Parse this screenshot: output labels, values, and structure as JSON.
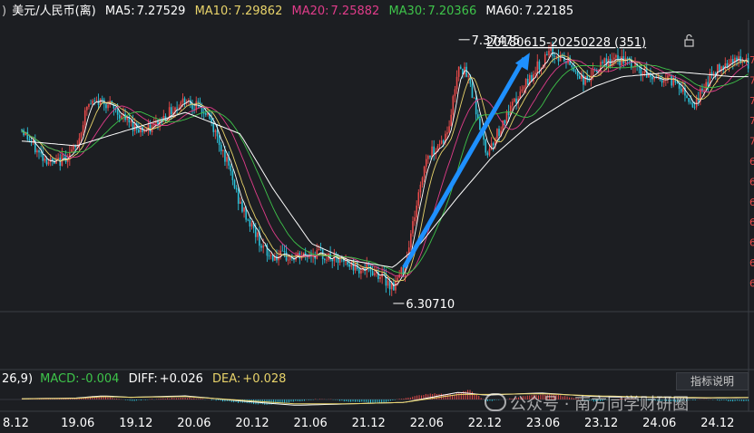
{
  "header": {
    "prefix": ")",
    "symbol": "美元/人民币(离)",
    "ma": [
      {
        "label": "MA5:",
        "value": "7.27529",
        "color": "#ffffff"
      },
      {
        "label": "MA10:",
        "value": "7.29862",
        "color": "#e8d36a"
      },
      {
        "label": "MA20:",
        "value": "7.25882",
        "color": "#e03c8a"
      },
      {
        "label": "MA30:",
        "value": "7.20366",
        "color": "#3ec44a"
      },
      {
        "label": "MA60:",
        "value": "7.22185",
        "color": "#ffffff"
      }
    ]
  },
  "macd_header": {
    "params": "26,9)",
    "macd_label": "MACD:",
    "macd_value": "-0.004",
    "diff_label": "DIFF:",
    "diff_value": "+0.026",
    "dea_label": "DEA:",
    "dea_value": "+0.028"
  },
  "indicator_button": "指标说明",
  "watermark": "公众号 · 南方同学财研圈",
  "colors": {
    "up": "#e84a4a",
    "down": "#2bc0d8",
    "background": "#1c1e22",
    "arrow": "#1e90ff",
    "ma5": "#ffffff",
    "ma10": "#e8d36a",
    "ma20": "#e03c8a",
    "ma30": "#3ec44a",
    "ma60": "#ffffff"
  },
  "chart_data": {
    "type": "candlestick",
    "x_ticks": [
      "8.12",
      "19.06",
      "19.12",
      "20.06",
      "20.12",
      "21.06",
      "21.12",
      "22.06",
      "22.12",
      "23.06",
      "23.12",
      "24.06",
      "24.12"
    ],
    "ylim": [
      6.25,
      7.45
    ],
    "price_path": [
      [
        0,
        7.0
      ],
      [
        0.3,
        6.9
      ],
      [
        0.6,
        6.85
      ],
      [
        1.0,
        6.92
      ],
      [
        1.2,
        7.1
      ],
      [
        1.5,
        7.12
      ],
      [
        2.0,
        7.02
      ],
      [
        2.3,
        6.99
      ],
      [
        2.6,
        7.05
      ],
      [
        3.0,
        7.13
      ],
      [
        3.4,
        7.06
      ],
      [
        3.7,
        6.9
      ],
      [
        4.0,
        6.68
      ],
      [
        4.5,
        6.47
      ],
      [
        5.0,
        6.46
      ],
      [
        5.4,
        6.48
      ],
      [
        6.0,
        6.43
      ],
      [
        6.5,
        6.4
      ],
      [
        6.8,
        6.34
      ],
      [
        7.0,
        6.42
      ],
      [
        7.4,
        6.88
      ],
      [
        7.8,
        6.98
      ],
      [
        8.0,
        7.28
      ],
      [
        8.2,
        7.2
      ],
      [
        8.5,
        6.9
      ],
      [
        8.8,
        7.02
      ],
      [
        9.0,
        7.1
      ],
      [
        9.4,
        7.25
      ],
      [
        9.7,
        7.32
      ],
      [
        10.0,
        7.28
      ],
      [
        10.3,
        7.2
      ],
      [
        10.7,
        7.28
      ],
      [
        11.0,
        7.29
      ],
      [
        11.5,
        7.22
      ],
      [
        12.0,
        7.2
      ],
      [
        12.3,
        7.1
      ],
      [
        12.6,
        7.22
      ],
      [
        13.0,
        7.3
      ],
      [
        13.3,
        7.27
      ]
    ],
    "ma60_path": [
      [
        0,
        6.95
      ],
      [
        1.0,
        6.93
      ],
      [
        2.0,
        7.0
      ],
      [
        3.0,
        7.07
      ],
      [
        4.0,
        6.98
      ],
      [
        4.6,
        6.75
      ],
      [
        5.3,
        6.52
      ],
      [
        6.0,
        6.45
      ],
      [
        6.8,
        6.42
      ],
      [
        7.3,
        6.52
      ],
      [
        8.0,
        6.72
      ],
      [
        8.6,
        6.88
      ],
      [
        9.3,
        7.02
      ],
      [
        10.0,
        7.12
      ],
      [
        10.5,
        7.18
      ],
      [
        11.0,
        7.22
      ],
      [
        12.0,
        7.24
      ],
      [
        13.0,
        7.22
      ],
      [
        13.3,
        7.22
      ]
    ],
    "high_marker": {
      "label": "7.37475",
      "value": 7.37475,
      "x_pos": 8.0
    },
    "low_marker": {
      "label": "6.30710",
      "value": 6.3071,
      "x_pos": 6.8
    },
    "range_label": "20180615-20250228 (351)",
    "arrow": {
      "from": [
        7.0,
        6.42
      ],
      "to": [
        9.3,
        7.32
      ]
    },
    "right_axis_ticks": [
      "7",
      "7",
      "7",
      "7",
      "7",
      "6",
      "6",
      "6",
      "6",
      "6",
      "6",
      "6"
    ],
    "macd": [
      [
        0,
        0.001
      ],
      [
        1.0,
        0.004
      ],
      [
        1.3,
        0.01
      ],
      [
        1.6,
        0.006
      ],
      [
        2.0,
        -0.004
      ],
      [
        2.6,
        0.003
      ],
      [
        3.0,
        0.006
      ],
      [
        3.5,
        -0.002
      ],
      [
        4.0,
        -0.01
      ],
      [
        4.5,
        -0.016
      ],
      [
        5.0,
        -0.006
      ],
      [
        5.5,
        0.002
      ],
      [
        6.0,
        -0.006
      ],
      [
        6.6,
        -0.011
      ],
      [
        7.0,
        0.004
      ],
      [
        7.5,
        0.018
      ],
      [
        7.9,
        0.014
      ],
      [
        8.2,
        0.03
      ],
      [
        8.5,
        -0.006
      ],
      [
        8.9,
        0.002
      ],
      [
        9.3,
        0.012
      ],
      [
        9.7,
        0.016
      ],
      [
        10.0,
        0.008
      ],
      [
        10.5,
        -0.006
      ],
      [
        11.0,
        0.004
      ],
      [
        11.5,
        -0.003
      ],
      [
        12.0,
        -0.006
      ],
      [
        12.5,
        0.001
      ],
      [
        13.0,
        -0.005
      ],
      [
        13.3,
        -0.004
      ]
    ],
    "diff": [
      [
        0,
        0.01
      ],
      [
        1.0,
        0.02
      ],
      [
        1.5,
        0.05
      ],
      [
        2.0,
        0.03
      ],
      [
        3.0,
        0.05
      ],
      [
        4.0,
        -0.02
      ],
      [
        5.0,
        -0.08
      ],
      [
        6.0,
        -0.06
      ],
      [
        7.0,
        -0.04
      ],
      [
        8.0,
        0.1
      ],
      [
        8.5,
        0.06
      ],
      [
        9.5,
        0.09
      ],
      [
        10.5,
        0.04
      ],
      [
        11.5,
        0.03
      ],
      [
        12.5,
        0.02
      ],
      [
        13.3,
        0.026
      ]
    ],
    "dea": [
      [
        0,
        0.01
      ],
      [
        1.0,
        0.015
      ],
      [
        1.5,
        0.04
      ],
      [
        2.0,
        0.03
      ],
      [
        3.0,
        0.04
      ],
      [
        4.0,
        -0.01
      ],
      [
        5.0,
        -0.06
      ],
      [
        6.0,
        -0.06
      ],
      [
        7.0,
        -0.04
      ],
      [
        8.0,
        0.07
      ],
      [
        8.5,
        0.07
      ],
      [
        9.5,
        0.08
      ],
      [
        10.5,
        0.05
      ],
      [
        11.5,
        0.035
      ],
      [
        12.5,
        0.025
      ],
      [
        13.3,
        0.028
      ]
    ]
  }
}
